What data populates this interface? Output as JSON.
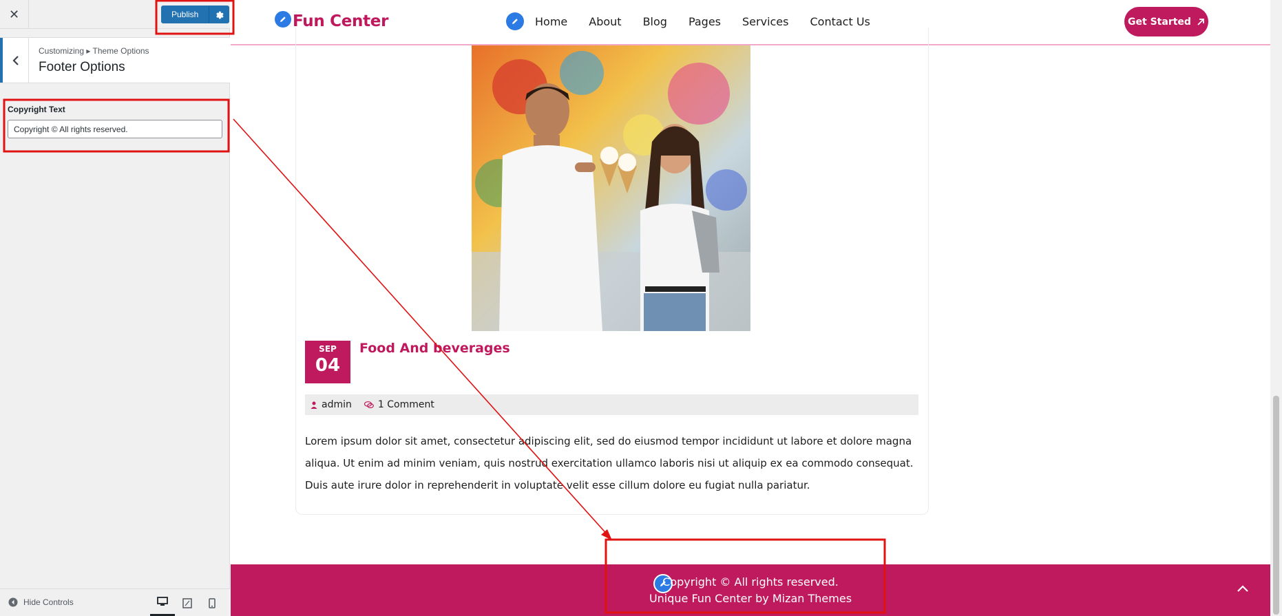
{
  "customizer": {
    "close_label": "✕",
    "publish_label": "Publish",
    "breadcrumb": "Customizing ▸ Theme Options",
    "section_title": "Footer Options",
    "field_label": "Copyright Text",
    "field_value": "Copyright © All rights reserved.",
    "hide_controls": "Hide Controls",
    "accent": "#2271b1"
  },
  "site": {
    "logo": "Fun Center",
    "nav": [
      "Home",
      "About",
      "Blog",
      "Pages",
      "Services",
      "Contact Us"
    ],
    "cta": "Get Started",
    "brand_color": "#bf1a5d",
    "post": {
      "month": "SEP",
      "day": "04",
      "title": "Food And beverages",
      "author": "admin",
      "comments": "1 Comment",
      "excerpt": "Lorem ipsum dolor sit amet, consectetur adipiscing elit, sed do eiusmod tempor incididunt ut labore et dolore magna aliqua. Ut enim ad minim veniam, quis nostrud exercitation ullamco laboris nisi ut aliquip ex ea commodo consequat. Duis aute irure dolor in reprehenderit in voluptate velit esse cillum dolore eu fugiat nulla pariatur."
    },
    "footer": {
      "copyright": "Copyright © All rights reserved.",
      "credit": "Unique Fun Center by Mizan Themes"
    }
  }
}
